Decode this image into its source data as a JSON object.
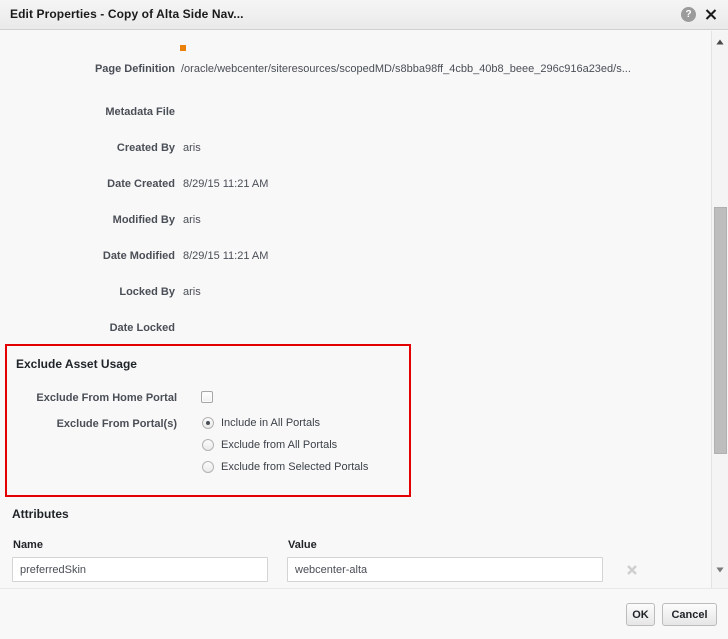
{
  "window": {
    "title": "Edit Properties - Copy of Alta Side Nav...",
    "help_icon": "help-circle-icon",
    "close_icon": "close-icon"
  },
  "properties": [
    {
      "label": "Page Definition",
      "value": "/oracle/webcenter/siteresources/scopedMD/s8bba98ff_4cbb_40b8_beee_296c916a23ed/s...",
      "required": true
    },
    {
      "label": "Metadata File",
      "value": "",
      "required": false
    },
    {
      "label": "Created By",
      "value": "aris",
      "required": false
    },
    {
      "label": "Date Created",
      "value": "8/29/15 11:21 AM",
      "required": false
    },
    {
      "label": "Modified By",
      "value": "aris",
      "required": false
    },
    {
      "label": "Date Modified",
      "value": "8/29/15 11:21 AM",
      "required": false
    },
    {
      "label": "Locked By",
      "value": "aris",
      "required": false
    },
    {
      "label": "Date Locked",
      "value": "",
      "required": false
    }
  ],
  "exclude_asset_usage": {
    "heading": "Exclude Asset Usage",
    "highlight_color": "#e40000",
    "home_portal": {
      "label": "Exclude From Home Portal",
      "checked": false
    },
    "portals": {
      "label": "Exclude From Portal(s)",
      "selected_index": 0,
      "options": [
        "Include in All Portals",
        "Exclude from All Portals",
        "Exclude from Selected Portals"
      ]
    }
  },
  "attributes": {
    "heading": "Attributes",
    "columns": [
      "Name",
      "Value"
    ],
    "rows": [
      {
        "name": "preferredSkin",
        "value": "webcenter-alta",
        "delete_icon": "close-x-icon"
      }
    ]
  },
  "scrollbar": {
    "up_icon": "triangle-up-icon",
    "down_icon": "triangle-down-icon",
    "thumb_top_pct": 32,
    "thumb_height_pct": 44
  },
  "footer": {
    "ok_label": "OK",
    "cancel_label": "Cancel"
  },
  "colors": {
    "accent_required": "#e8820c",
    "highlight": "#e40000",
    "background": "#f8f8f8",
    "label_text": "#4a4e56"
  }
}
